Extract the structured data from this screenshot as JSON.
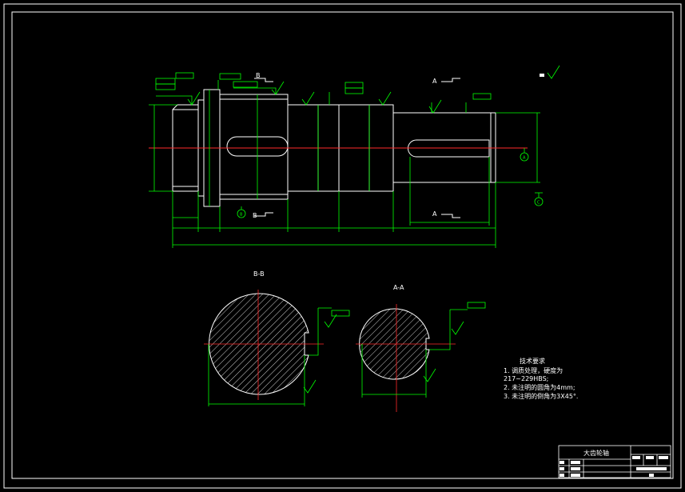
{
  "colors": {
    "background": "#000000",
    "outline": "#ffffff",
    "dimension": "#00ff00",
    "centerline": "#ff2a2a",
    "hatch": "#ffffff"
  },
  "views": {
    "section_marks": {
      "b_top": "B",
      "b_bottom": "B",
      "a_top": "A",
      "a_bottom": "A"
    },
    "section_bb": {
      "title": "B-B"
    },
    "section_aa": {
      "title": "A-A"
    },
    "datums": {
      "a": "A",
      "b": "B",
      "c": "C"
    }
  },
  "tech_requirements": {
    "title": "技术要求",
    "lines": [
      "1. 调质处理，硬度为",
      "217~229HBS;",
      "2. 未注明的圆角为4mm;",
      "3. 未注明的倒角为3X45°."
    ]
  },
  "title_block": {
    "name": "大齿轮轴"
  }
}
